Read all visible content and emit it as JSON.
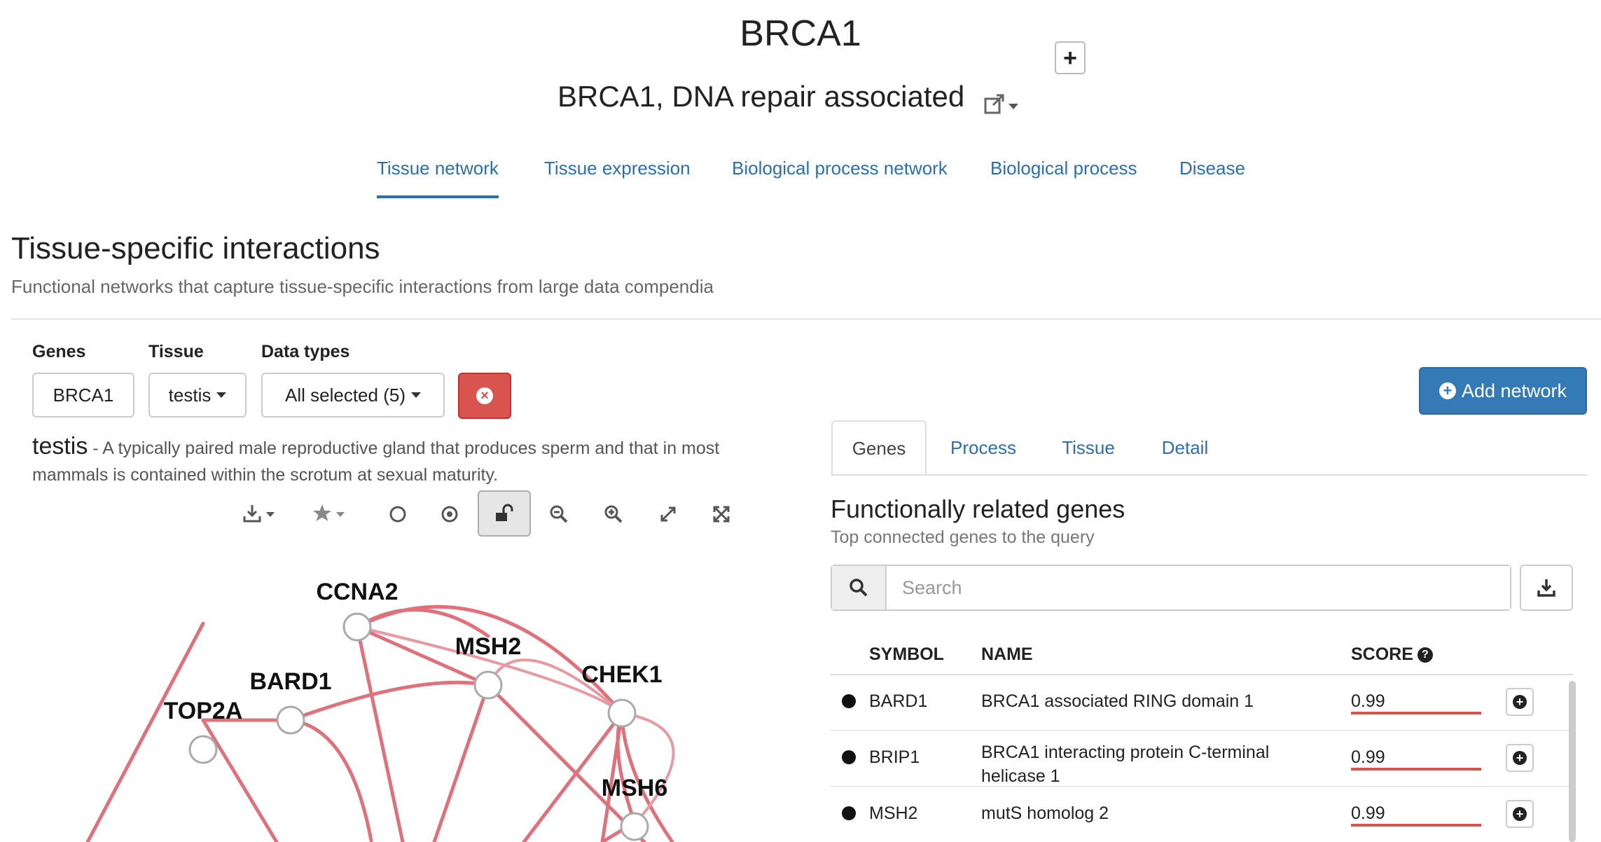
{
  "header": {
    "gene_symbol": "BRCA1",
    "gene_name": "BRCA1, DNA repair associated",
    "add_icon": "plus-icon",
    "external_link_icon": "external-link-icon"
  },
  "nav": {
    "tabs": [
      {
        "label": "Tissue network",
        "active": true
      },
      {
        "label": "Tissue expression"
      },
      {
        "label": "Biological process network"
      },
      {
        "label": "Biological process"
      },
      {
        "label": "Disease"
      }
    ]
  },
  "section": {
    "title": "Tissue-specific interactions",
    "description": "Functional networks that capture tissue-specific interactions from large data compendia"
  },
  "filters": {
    "genes_label": "Genes",
    "genes_value": "BRCA1",
    "tissue_label": "Tissue",
    "tissue_value": "testis",
    "datatypes_label": "Data types",
    "datatypes_value": "All selected (5)"
  },
  "add_network_label": "Add network",
  "tissue_info": {
    "name": "testis",
    "description": " - A typically paired male reproductive gland that produces sperm and that in most mammals is contained within the scrotum at sexual maturity."
  },
  "toolbar": {
    "icons": [
      "download-icon",
      "star-icon",
      "circle-icon",
      "target-icon",
      "unlock-icon",
      "zoom-out-icon",
      "zoom-in-icon",
      "expand-icon",
      "fit-icon"
    ]
  },
  "network": {
    "nodes": [
      "CCNA2",
      "MSH2",
      "CHEK1",
      "BARD1",
      "TOP2A",
      "MSH6"
    ],
    "edge_color": "#e0707a"
  },
  "right_tabs": [
    {
      "label": "Genes",
      "active": true
    },
    {
      "label": "Process"
    },
    {
      "label": "Tissue"
    },
    {
      "label": "Detail"
    }
  ],
  "related": {
    "title": "Functionally related genes",
    "subtitle": "Top connected genes to the query",
    "search_placeholder": "Search",
    "columns": {
      "symbol": "SYMBOL",
      "name": "NAME",
      "score": "SCORE"
    },
    "rows": [
      {
        "symbol": "BARD1",
        "name": "BRCA1 associated RING domain 1",
        "score": "0.99"
      },
      {
        "symbol": "BRIP1",
        "name": "BRCA1 interacting protein C-terminal helicase 1",
        "score": "0.99"
      },
      {
        "symbol": "MSH2",
        "name": "mutS homolog 2",
        "score": "0.99"
      }
    ]
  },
  "colors": {
    "link": "#2a6fb5",
    "primary": "#337ab7",
    "danger": "#d9534f"
  }
}
